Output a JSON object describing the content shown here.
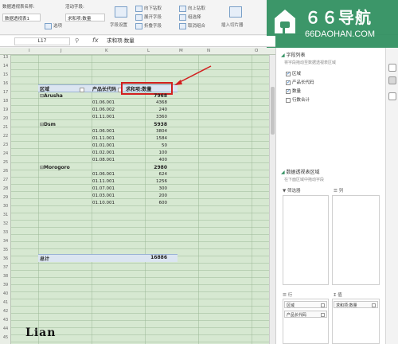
{
  "ribbon": {
    "pivot_name_label": "数据透视表名称:",
    "pivot_name_value": "数据透视表1",
    "active_field_label": "活动字段:",
    "active_field_value": "求和项:数量",
    "options_label": "选项",
    "field_settings_label": "字段设置",
    "expand_field_label": "展开字段",
    "collapse_field_label": "折叠字段",
    "group_selection_label": "组选择",
    "ungroup_label": "取消组合",
    "insert_slicer_label": "插入切片器",
    "top_text_1": "向下钻取",
    "top_text_2": "向上钻取"
  },
  "watermark": {
    "title": "６６导航",
    "subtitle": "66DAOHAN.COM"
  },
  "formula_bar": {
    "cell_ref": "L17",
    "fx": "fx",
    "formula": "求和项:数量"
  },
  "sheet": {
    "columns": [
      "I",
      "J",
      "K",
      "L",
      "M",
      "N",
      "O"
    ],
    "rows": [
      "13",
      "14",
      "15",
      "16",
      "17",
      "18",
      "19",
      "20",
      "21",
      "22",
      "23",
      "24",
      "25",
      "26",
      "27",
      "28",
      "29",
      "30",
      "31",
      "32",
      "33",
      "34",
      "35",
      "36",
      "37",
      "38",
      "39",
      "40",
      "41",
      "42",
      "43",
      "44",
      "45"
    ],
    "pivot": {
      "header_region": "区域",
      "header_code": "产品长代码",
      "header_value": "求和项:数量",
      "groups": [
        {
          "name": "Arusha",
          "total": "7968",
          "items": [
            {
              "code": "01.06.001",
              "value": "4368"
            },
            {
              "code": "01.06.002",
              "value": "240"
            },
            {
              "code": "01.11.001",
              "value": "3360"
            }
          ]
        },
        {
          "name": "Dsm",
          "total": "5938",
          "items": [
            {
              "code": "01.06.001",
              "value": "3804"
            },
            {
              "code": "01.11.001",
              "value": "1584"
            },
            {
              "code": "01.01.001",
              "value": "50"
            },
            {
              "code": "01.02.001",
              "value": "100"
            },
            {
              "code": "01.08.001",
              "value": "400"
            }
          ]
        },
        {
          "name": "Morogoro",
          "total": "2980",
          "items": [
            {
              "code": "01.06.001",
              "value": "624"
            },
            {
              "code": "01.11.001",
              "value": "1256"
            },
            {
              "code": "01.07.001",
              "value": "300"
            },
            {
              "code": "01.03.001",
              "value": "200"
            },
            {
              "code": "01.10.001",
              "value": "600"
            }
          ]
        }
      ],
      "grand_total_label": "总计",
      "grand_total_value": "16886"
    },
    "highlight_color": "#d21f1f"
  },
  "signature": "Lian",
  "panel": {
    "field_list_title": "字段列表",
    "field_list_hint": "将字段拖动至数据透视表区域",
    "fields": [
      {
        "label": "区域",
        "checked": true
      },
      {
        "label": "产品长代码",
        "checked": true
      },
      {
        "label": "数量",
        "checked": true
      },
      {
        "label": "行数合计",
        "checked": false
      }
    ],
    "areas_title": "数据透视表区域",
    "areas_hint": "在下面区域中拖动字段",
    "filter_label": "筛选器",
    "columns_label": "列",
    "rows_label": "行",
    "values_label": "值",
    "row_chips": [
      "区域",
      "产品长代码"
    ],
    "value_chips": [
      "求和项:数量"
    ]
  }
}
